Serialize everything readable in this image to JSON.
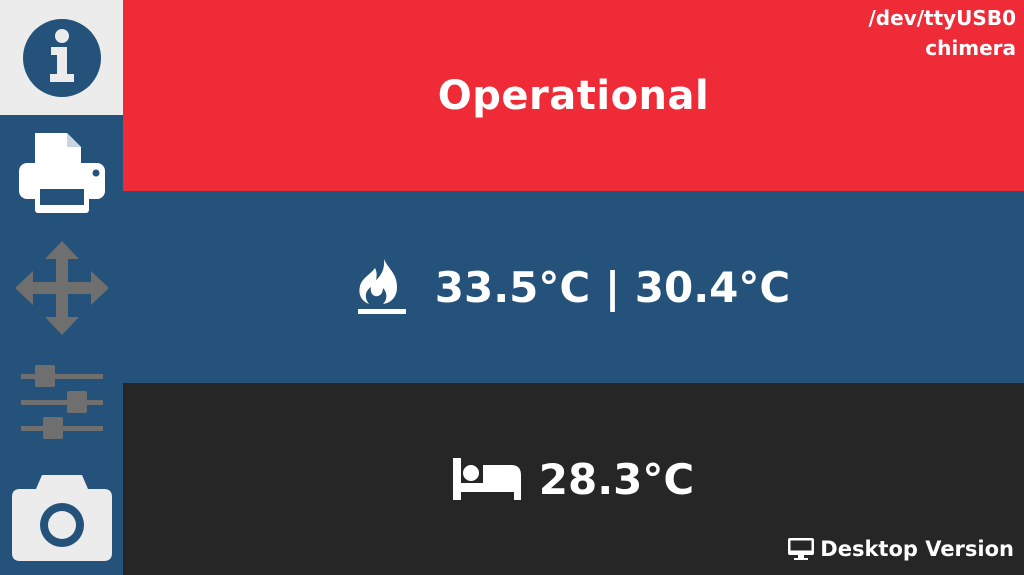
{
  "colors": {
    "sidebar": "#24527a",
    "sidebar_active": "#ececec",
    "status_bg": "#ef2b38",
    "hotend_bg": "#24527a",
    "bed_bg": "#262626",
    "icon_active": "#24527a",
    "icon_default": "#ffffff",
    "icon_disabled": "#6f6f6f"
  },
  "connection": {
    "port": "/dev/ttyUSB0",
    "name": "chimera"
  },
  "status": {
    "text": "Operational"
  },
  "hotend": {
    "icon": "fire-icon",
    "temps": "33.5°C | 30.4°C"
  },
  "bed": {
    "icon": "bed-icon",
    "temp": "28.3°C"
  },
  "footer": {
    "desktop_label": "Desktop Version",
    "icon": "monitor-icon"
  },
  "sidebar": {
    "items": [
      {
        "name": "info",
        "icon": "info-icon",
        "active": true
      },
      {
        "name": "print",
        "icon": "printer-icon",
        "active": false
      },
      {
        "name": "move",
        "icon": "move-arrows-icon",
        "active": false,
        "disabled": true
      },
      {
        "name": "control",
        "icon": "sliders-icon",
        "active": false,
        "disabled": true
      },
      {
        "name": "webcam",
        "icon": "camera-icon",
        "active": false
      }
    ]
  }
}
